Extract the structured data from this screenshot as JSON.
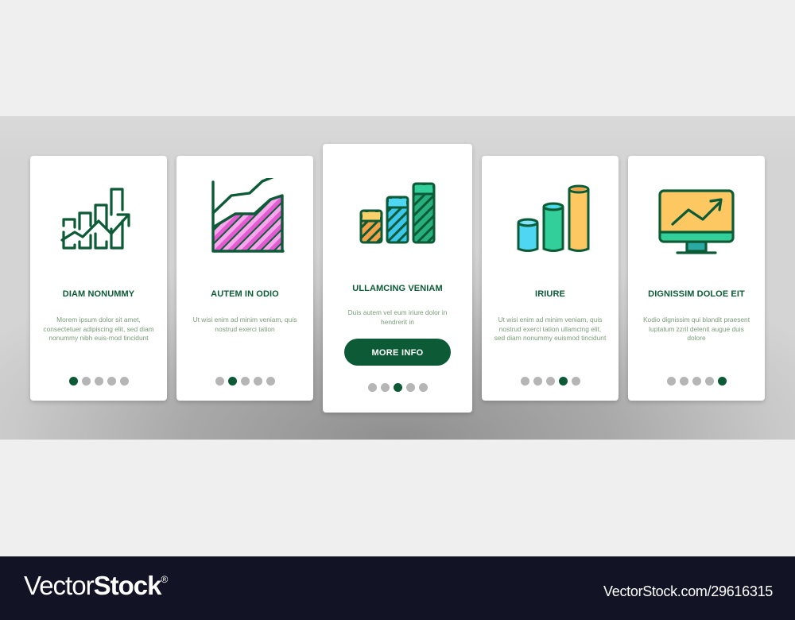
{
  "colors": {
    "brand_green": "#0c5a36",
    "text_muted": "#7a9c77",
    "dot_inactive": "#b5b5b5",
    "footer_bg": "#121426",
    "pink_light": "#f7a8ec",
    "pink_dark": "#e45ad2",
    "orange": "#f4a24a",
    "yellow": "#fdd16a",
    "cyan": "#4fd6f2",
    "teal_green": "#33cf9b"
  },
  "cards": [
    {
      "icon": "bar-chart-growth-arrow-icon",
      "title": "DIAM NONUMMY",
      "description": "Morem ipsum dolor sit amet, consectetuer adipiscing elit, sed diam nonummy nibh euis-mod tincidunt",
      "active_page": 1,
      "total_pages": 5
    },
    {
      "icon": "area-chart-icon",
      "title": "AUTEM IN ODIO",
      "description": "Ut wisi enim ad minim veniam, quis nostrud exerci tation",
      "active_page": 2,
      "total_pages": 5
    },
    {
      "icon": "striped-bar-chart-icon",
      "title": "ULLAMCING VENIAM",
      "description": "Duis autem vel eum iriure dolor in hendrerit in",
      "button_label": "MORE INFO",
      "active_page": 3,
      "total_pages": 5
    },
    {
      "icon": "cylinder-bar-chart-icon",
      "title": "IRIURE",
      "description": "Ut wisi enim ad minim veniam, quis nostrud exerci tation ullamcing elit, sed diam nonummy euismod tincidunt",
      "active_page": 4,
      "total_pages": 5
    },
    {
      "icon": "monitor-growth-chart-icon",
      "title": "DIGNISSIM DOLOE EIT",
      "description": "Kodio dignissim qui blandit praesent luptatum zzril delenit augue duis dolore",
      "active_page": 5,
      "total_pages": 5
    }
  ],
  "footer": {
    "logo_light": "Vector",
    "logo_bold": "Stock",
    "logo_mark": "®",
    "image_id_text": "VectorStock.com/29616315"
  }
}
